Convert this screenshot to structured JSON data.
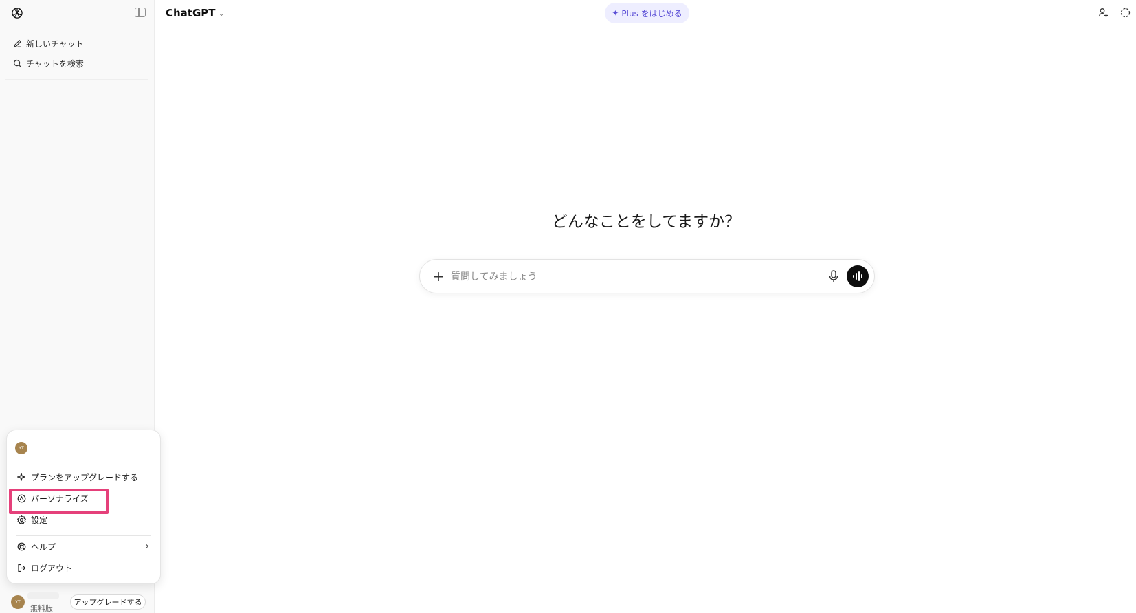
{
  "sidebar": {
    "items": [
      {
        "label": "新しいチャット",
        "icon": "new-chat-icon"
      },
      {
        "label": "チャットを検索",
        "icon": "search-icon"
      }
    ]
  },
  "account_menu": {
    "avatar_initials": "YT",
    "items": [
      {
        "label": "プランをアップグレードする",
        "icon": "sparkle-icon"
      },
      {
        "label": "パーソナライズ",
        "icon": "personalize-icon"
      },
      {
        "label": "設定",
        "icon": "gear-icon"
      },
      {
        "label": "ヘルプ",
        "icon": "lifebuoy-icon"
      },
      {
        "label": "ログアウト",
        "icon": "logout-icon"
      }
    ],
    "highlight_color": "#e5407a"
  },
  "footer": {
    "avatar_initials": "YT",
    "plan": "無料版",
    "upgrade_label": "アップグレードする"
  },
  "header": {
    "model_name": "ChatGPT",
    "plus_label": "Plus をはじめる",
    "plus_accent": "#5b4fd6"
  },
  "main": {
    "heading": "どんなことをしてますか？",
    "composer_placeholder": "質問してみましょう"
  }
}
